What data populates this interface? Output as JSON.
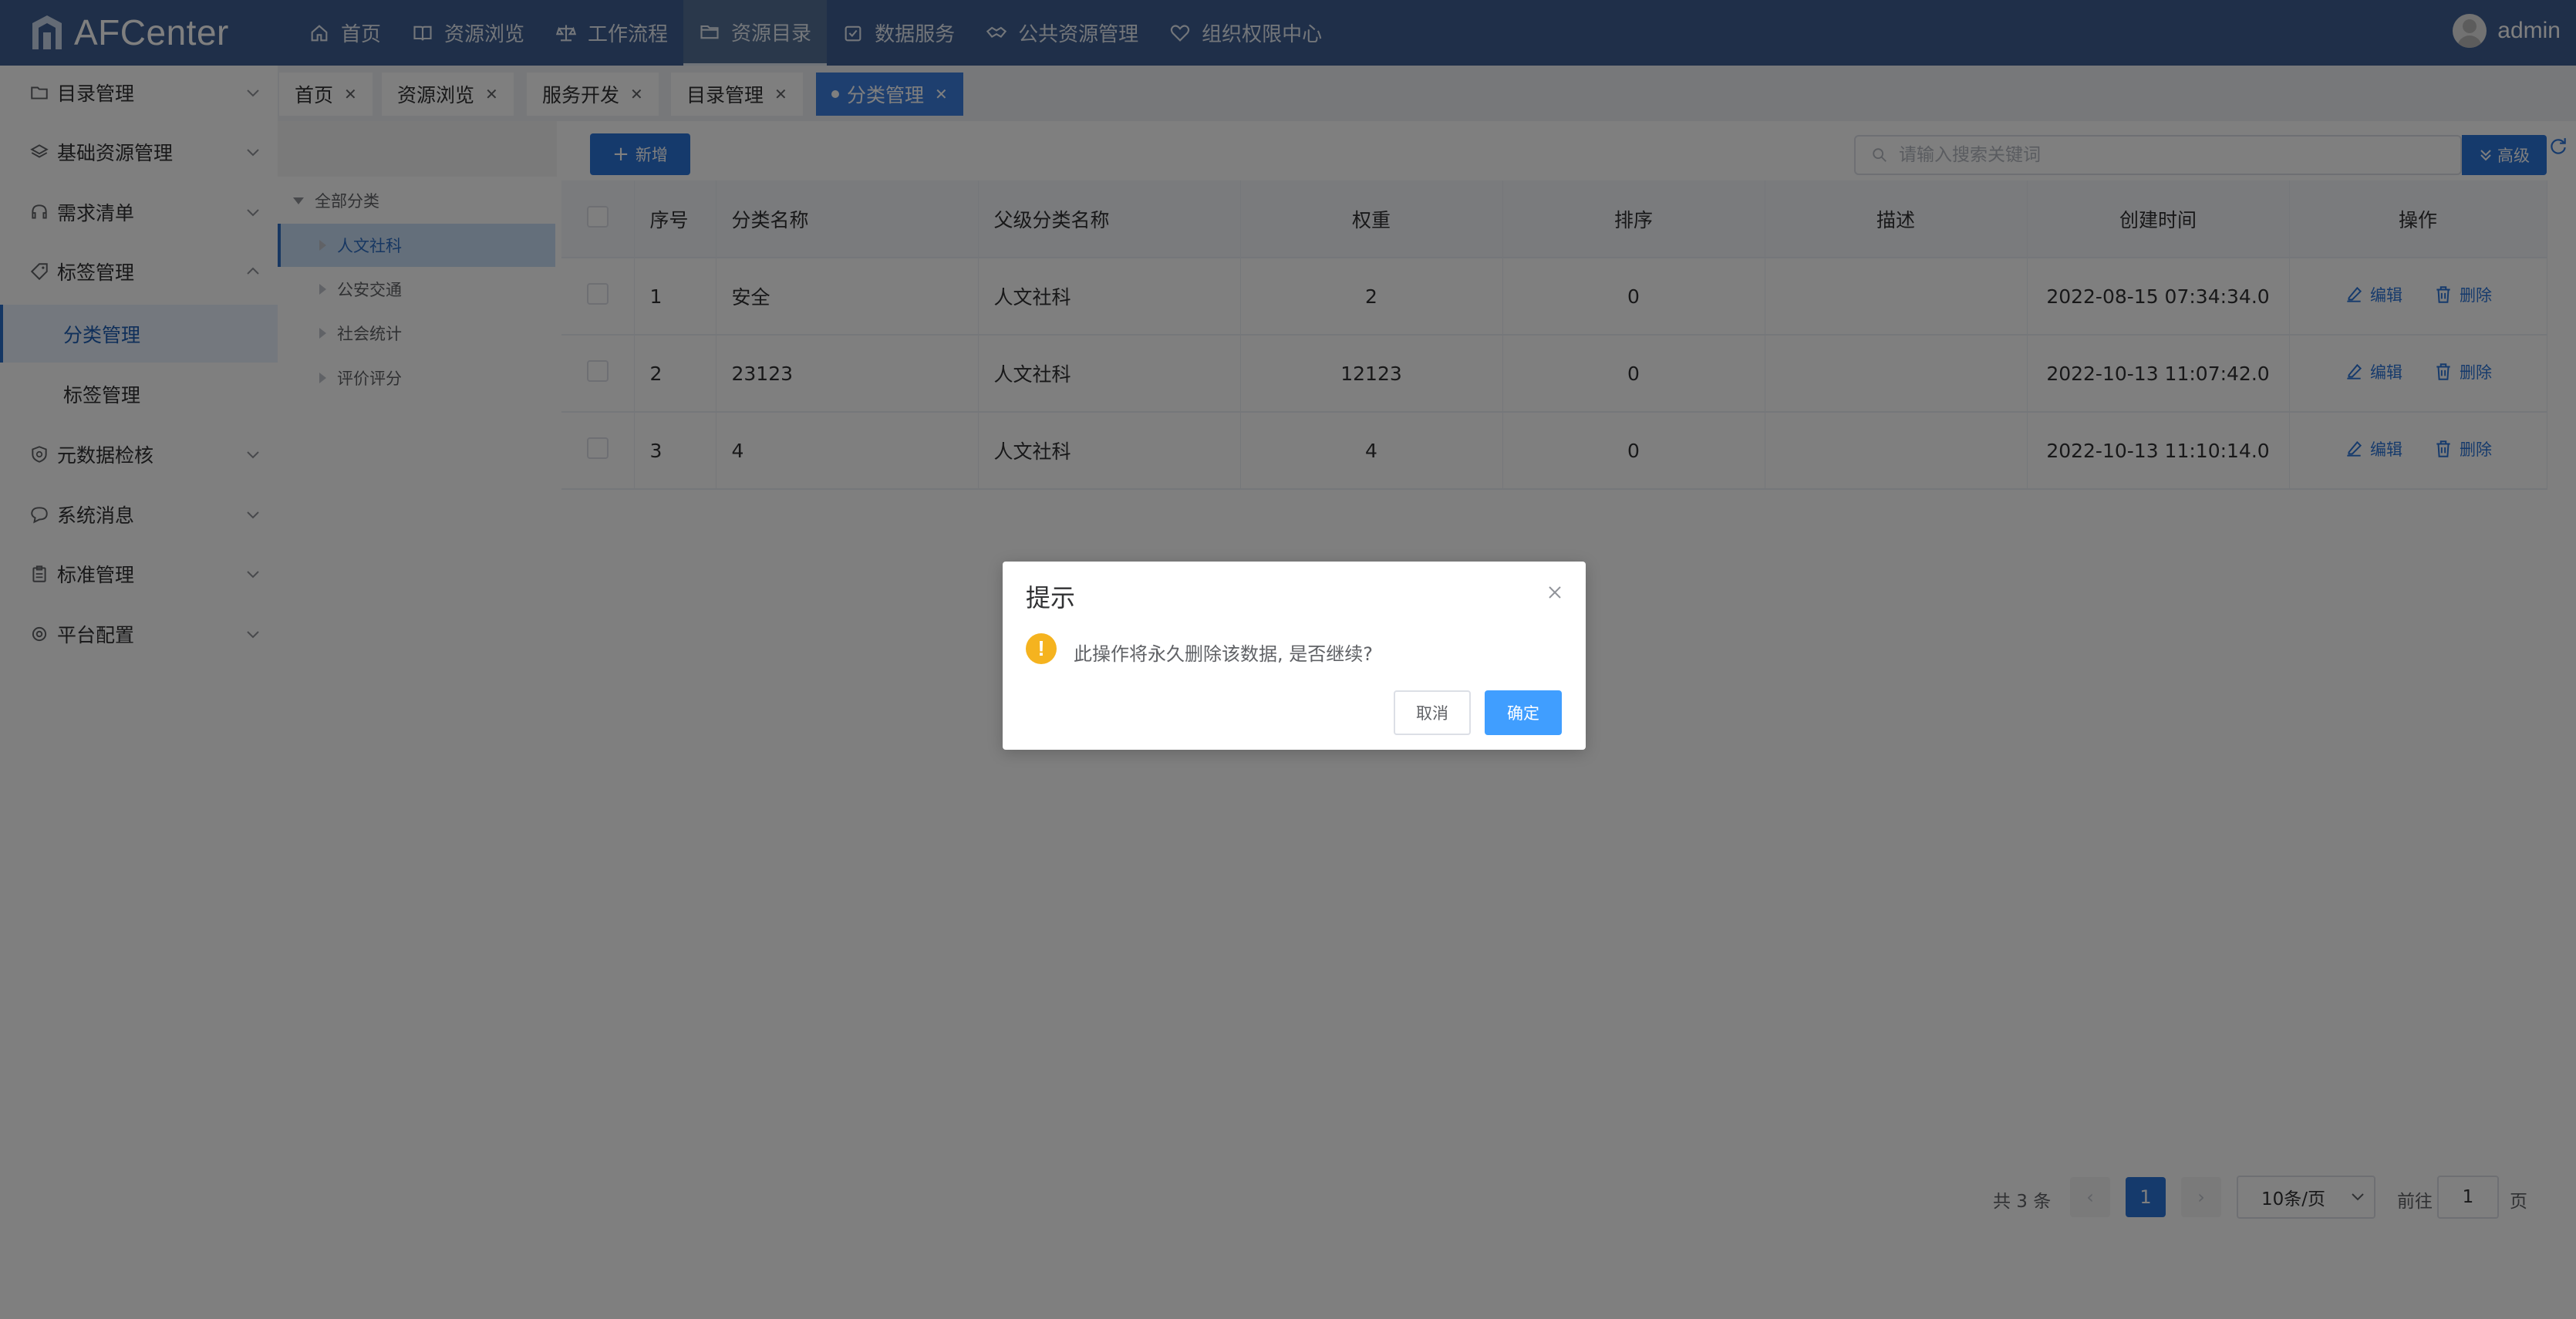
{
  "app": {
    "name": "AFCenter"
  },
  "topnav": [
    {
      "label": "首页",
      "icon": "home-icon"
    },
    {
      "label": "资源浏览",
      "icon": "book-icon"
    },
    {
      "label": "工作流程",
      "icon": "scale-icon"
    },
    {
      "label": "资源目录",
      "icon": "folder-icon",
      "active": true
    },
    {
      "label": "数据服务",
      "icon": "data-service-icon"
    },
    {
      "label": "公共资源管理",
      "icon": "handshake-icon"
    },
    {
      "label": "组织权限中心",
      "icon": "heart-shield-icon"
    }
  ],
  "user": {
    "name": "admin"
  },
  "sidebar": {
    "items": [
      {
        "label": "目录管理",
        "icon": "folder-icon"
      },
      {
        "label": "基础资源管理",
        "icon": "layers-icon"
      },
      {
        "label": "需求清单",
        "icon": "headset-icon"
      },
      {
        "label": "标签管理",
        "icon": "tag-icon",
        "expanded": true
      },
      {
        "label": "元数据检核",
        "icon": "shield-icon"
      },
      {
        "label": "系统消息",
        "icon": "chat-icon"
      },
      {
        "label": "标准管理",
        "icon": "clipboard-icon"
      },
      {
        "label": "平台配置",
        "icon": "gear-icon"
      }
    ],
    "subitems": [
      {
        "label": "分类管理",
        "active": true
      },
      {
        "label": "标签管理"
      }
    ]
  },
  "tabs": [
    {
      "label": "首页"
    },
    {
      "label": "资源浏览"
    },
    {
      "label": "服务开发"
    },
    {
      "label": "目录管理"
    },
    {
      "label": "分类管理",
      "active": true
    }
  ],
  "tree": {
    "root": "全部分类",
    "children": [
      "人文社科",
      "公安交通",
      "社会统计",
      "评价评分"
    ],
    "selected": "人文社科"
  },
  "toolbar": {
    "add_label": "新增",
    "search_placeholder": "请输入搜索关键词",
    "advanced_label": "高级"
  },
  "table": {
    "columns": [
      "序号",
      "分类名称",
      "父级分类名称",
      "权重",
      "排序",
      "描述",
      "创建时间",
      "操作"
    ],
    "rows": [
      {
        "no": "1",
        "name": "安全",
        "parent": "人文社科",
        "weight": "2",
        "order": "0",
        "desc": "",
        "created": "2022-08-15 07:34:34.0"
      },
      {
        "no": "2",
        "name": "23123",
        "parent": "人文社科",
        "weight": "12123",
        "order": "0",
        "desc": "",
        "created": "2022-10-13 11:07:42.0"
      },
      {
        "no": "3",
        "name": "4",
        "parent": "人文社科",
        "weight": "4",
        "order": "0",
        "desc": "",
        "created": "2022-10-13 11:10:14.0"
      }
    ],
    "actions": {
      "edit": "编辑",
      "delete": "删除"
    }
  },
  "pagination": {
    "total_text": "共 3 条",
    "current_page": "1",
    "page_size": "10条/页",
    "goto_label": "前往",
    "goto_value": "1",
    "page_suffix": "页"
  },
  "dialog": {
    "title": "提示",
    "message": "此操作将永久删除该数据, 是否继续?",
    "cancel": "取消",
    "confirm": "确定"
  },
  "colors": {
    "topbar": "#3e5f92",
    "primary": "#2b74d9",
    "confirm": "#409eff",
    "warning": "#f5b31f"
  }
}
